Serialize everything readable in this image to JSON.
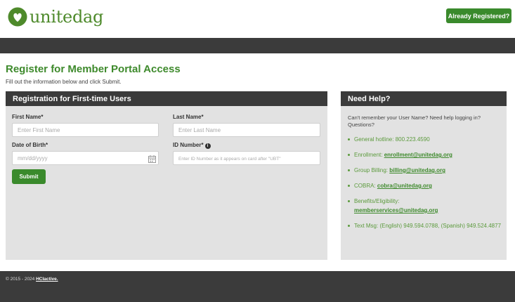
{
  "header": {
    "logo_text": "unitedag",
    "registered_button": "Already Registered?"
  },
  "page": {
    "title": "Register for Member Portal Access",
    "subtitle": "Fill out the information below and click Submit."
  },
  "registration": {
    "heading": "Registration for First-time Users",
    "first_name_label": "First Name*",
    "first_name_placeholder": "Enter First Name",
    "last_name_label": "Last Name*",
    "last_name_placeholder": "Enter Last Name",
    "dob_label": "Date of Birth*",
    "dob_placeholder": "mm/dd/yyyy",
    "id_label": "ID Number*",
    "id_placeholder": "Enter ID Number as it appears on card after \"UBT\"",
    "submit_label": "Submit"
  },
  "help": {
    "heading": "Need Help?",
    "intro": "Can't remember your User Name? Need help logging in? Questions?",
    "items": [
      {
        "text": "General hotline: 800.223.4590",
        "link": ""
      },
      {
        "text": "Enrollment: ",
        "link": "enrollment@unitedag.org"
      },
      {
        "text": "Group Billing: ",
        "link": "billing@unitedag.org"
      },
      {
        "text": "COBRA: ",
        "link": "cobra@unitedag.org"
      },
      {
        "text": "Benefits/Eligibility: ",
        "link": "memberservices@unitedag.org"
      },
      {
        "text": "Text Msg: (English) 949.594.0788, (Spanish) 949.524.4877",
        "link": ""
      }
    ]
  },
  "footer": {
    "copyright": "© 2015 - 2024 ",
    "link": "HCIactive."
  },
  "icons": {
    "logo": "leaf-heart-icon",
    "calendar": "calendar-icon",
    "info": "info-icon"
  },
  "colors": {
    "brand_green": "#3a8a2c",
    "dark_bar": "#3b3b3b",
    "panel_bg": "#e2e2e2"
  }
}
